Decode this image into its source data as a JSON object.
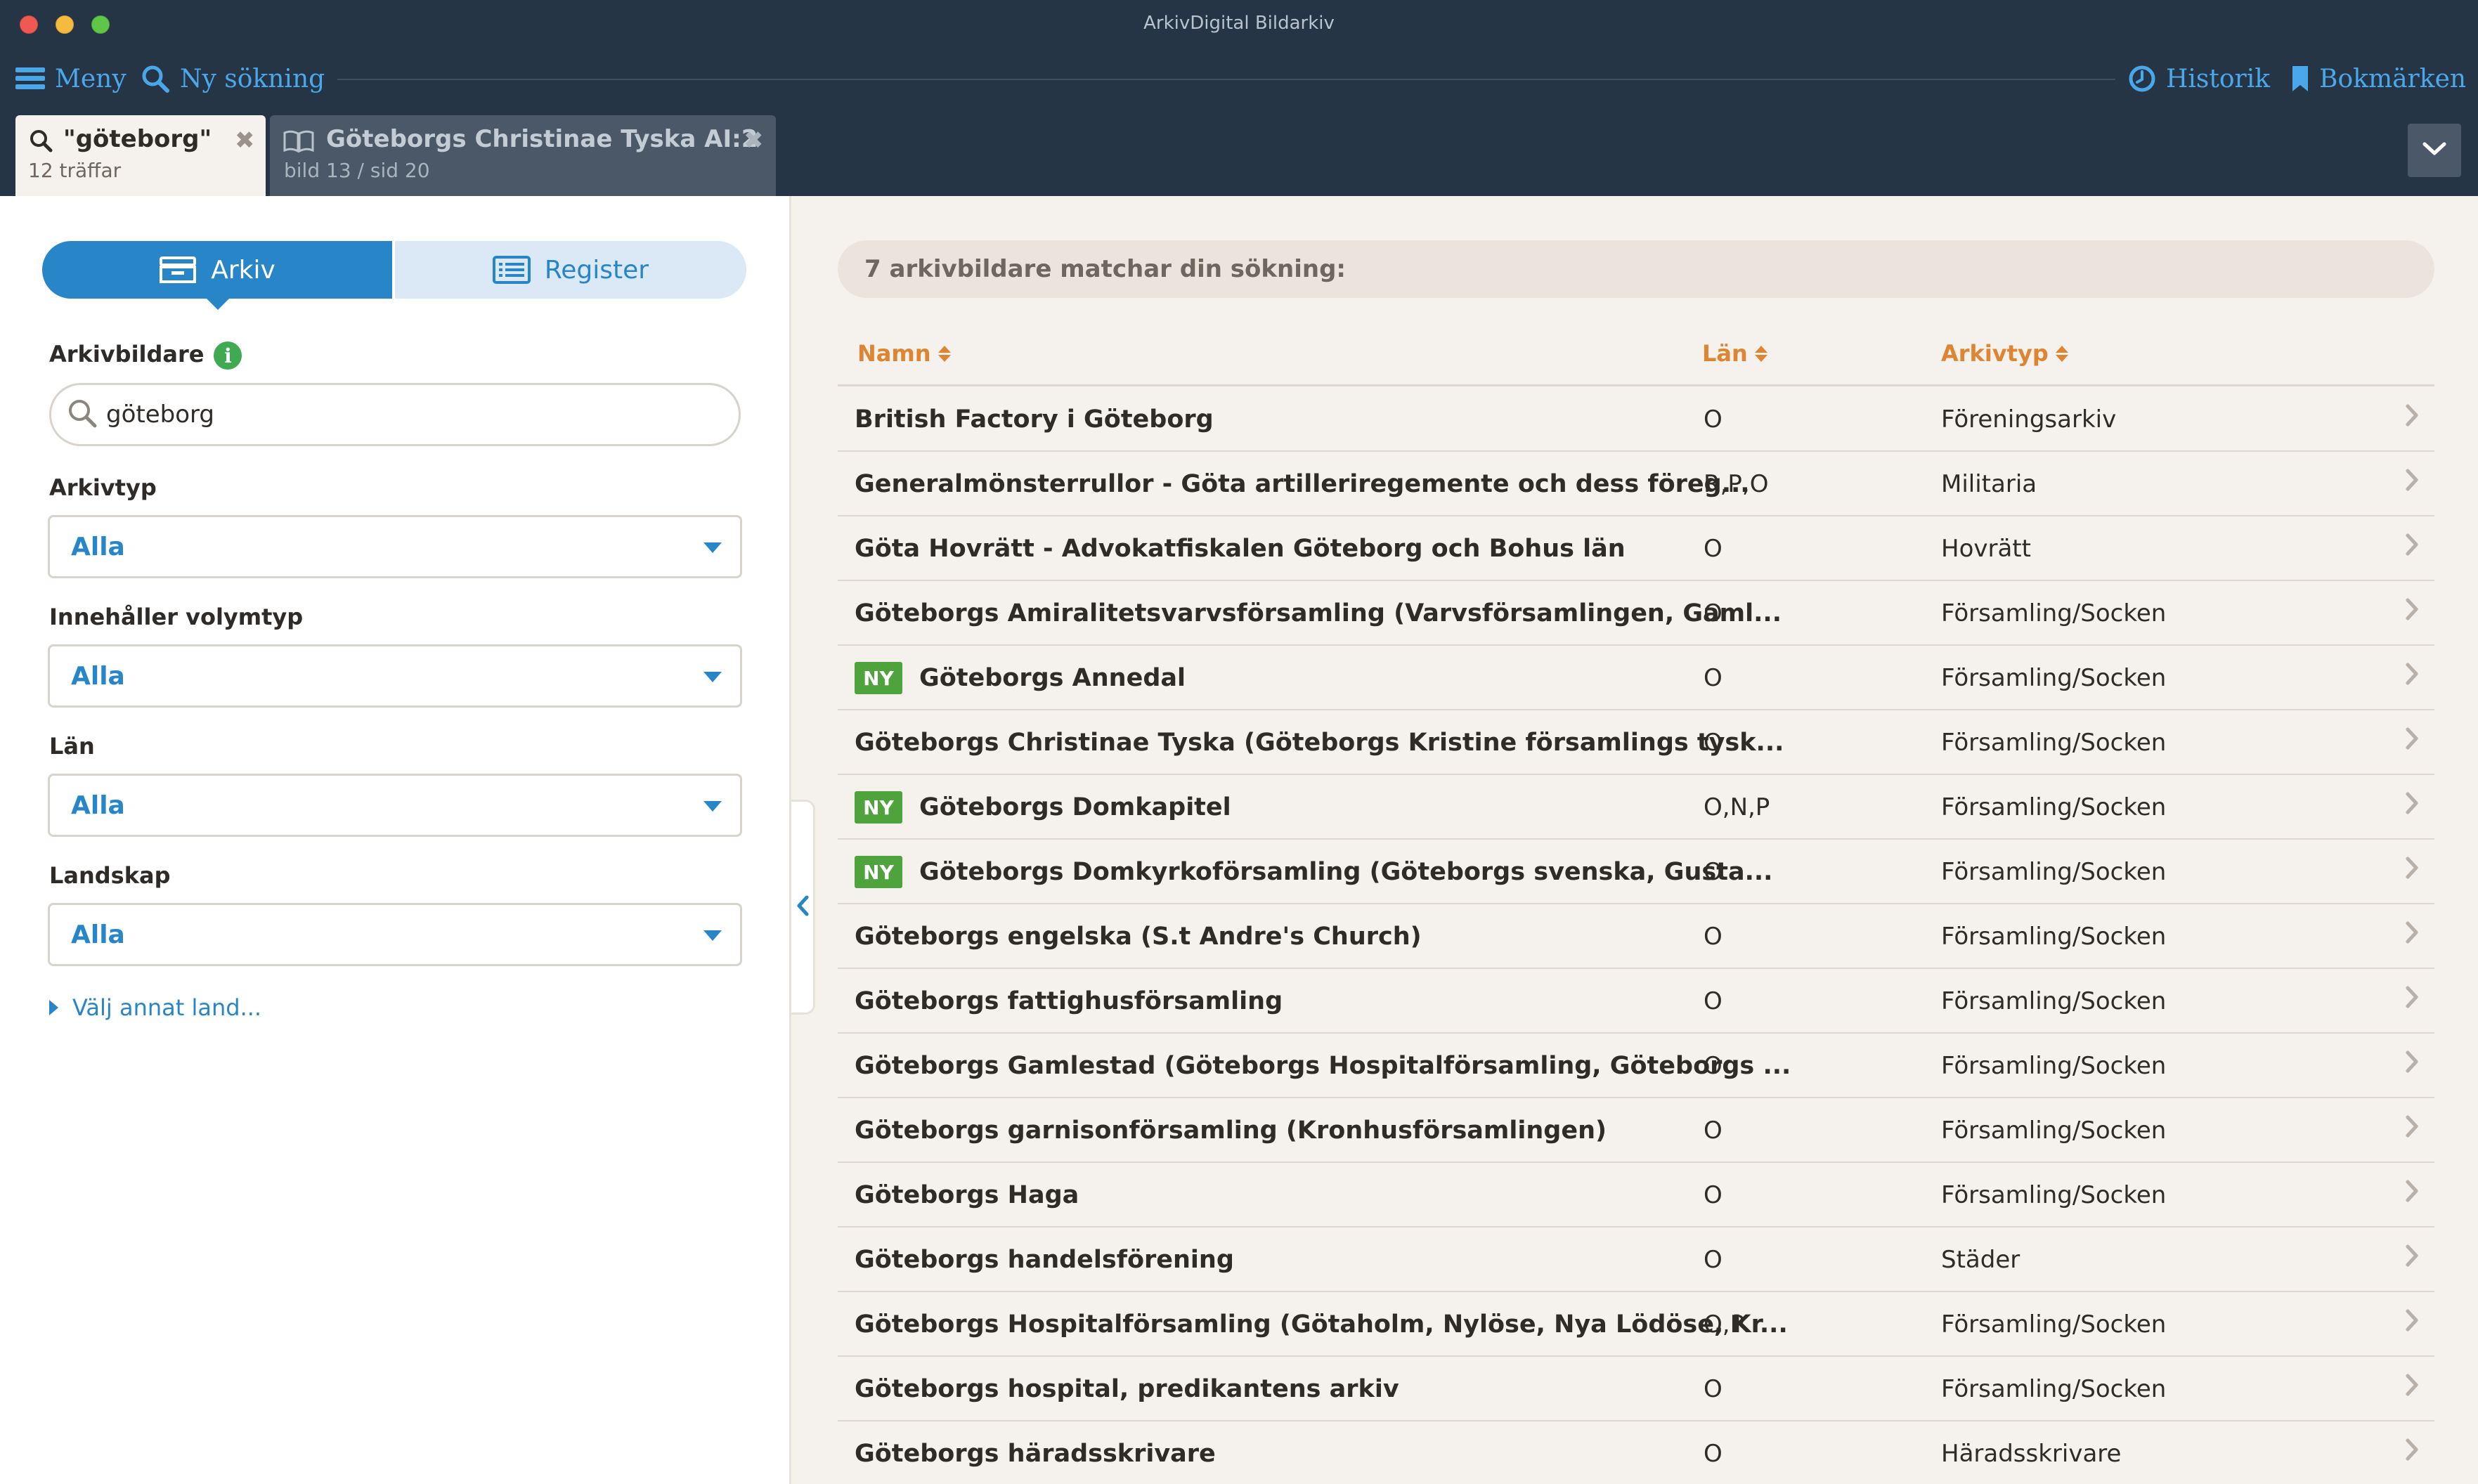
{
  "window": {
    "title": "ArkivDigital Bildarkiv"
  },
  "menubar": {
    "menu": "Meny",
    "new_search": "Ny sökning",
    "history": "Historik",
    "bookmarks": "Bokmärken"
  },
  "tabs": [
    {
      "title": "\"göteborg\"",
      "subtitle": "12 träffar",
      "icon": "search-icon",
      "active": true
    },
    {
      "title": "Göteborgs Christinae Tyska AI:2",
      "subtitle": "bild 13 / sid 20",
      "icon": "book-icon",
      "active": false
    }
  ],
  "sidebar": {
    "segments": {
      "arkiv": "Arkiv",
      "register": "Register"
    },
    "arkivbildare_label": "Arkivbildare",
    "search_value": "göteborg",
    "filters": [
      {
        "label": "Arkivtyp",
        "value": "Alla"
      },
      {
        "label": "Innehåller volymtyp",
        "value": "Alla"
      },
      {
        "label": "Län",
        "value": "Alla"
      },
      {
        "label": "Landskap",
        "value": "Alla"
      }
    ],
    "other_country": "Välj annat land..."
  },
  "results": {
    "banner": "7 arkivbildare matchar din sökning:",
    "columns": {
      "name": "Namn",
      "lan": "Län",
      "type": "Arkivtyp"
    },
    "badge_label": "NY",
    "rows": [
      {
        "name": "British Factory i Göteborg",
        "lan": "O",
        "type": "Föreningsarkiv",
        "new": false
      },
      {
        "name": "Generalmönsterrullor - Göta artilleriregemente och dess föreg...",
        "lan": "R,P,O",
        "type": "Militaria",
        "new": false
      },
      {
        "name": "Göta Hovrätt - Advokatfiskalen Göteborg och Bohus län",
        "lan": "O",
        "type": "Hovrätt",
        "new": false
      },
      {
        "name": "Göteborgs Amiralitetsvarvsförsamling (Varvsförsamlingen, Gaml...",
        "lan": "O",
        "type": "Församling/Socken",
        "new": false
      },
      {
        "name": "Göteborgs Annedal",
        "lan": "O",
        "type": "Församling/Socken",
        "new": true
      },
      {
        "name": "Göteborgs Christinae Tyska (Göteborgs Kristine församlings tysk...",
        "lan": "O",
        "type": "Församling/Socken",
        "new": false
      },
      {
        "name": "Göteborgs Domkapitel",
        "lan": "O,N,P",
        "type": "Församling/Socken",
        "new": true
      },
      {
        "name": "Göteborgs Domkyrkoförsamling (Göteborgs svenska, Gusta...",
        "lan": "O",
        "type": "Församling/Socken",
        "new": true
      },
      {
        "name": "Göteborgs engelska (S.t Andre's Church)",
        "lan": "O",
        "type": "Församling/Socken",
        "new": false
      },
      {
        "name": "Göteborgs fattighusförsamling",
        "lan": "O",
        "type": "Församling/Socken",
        "new": false
      },
      {
        "name": "Göteborgs Gamlestad (Göteborgs Hospitalförsamling, Göteborgs ...",
        "lan": "O",
        "type": "Församling/Socken",
        "new": false
      },
      {
        "name": "Göteborgs garnisonförsamling (Kronhusförsamlingen)",
        "lan": "O",
        "type": "Församling/Socken",
        "new": false
      },
      {
        "name": "Göteborgs Haga",
        "lan": "O",
        "type": "Församling/Socken",
        "new": false
      },
      {
        "name": "Göteborgs handelsförening",
        "lan": "O",
        "type": "Städer",
        "new": false
      },
      {
        "name": "Göteborgs Hospitalförsamling (Götaholm, Nylöse, Nya Lödöse, Kr...",
        "lan": "O,P",
        "type": "Församling/Socken",
        "new": false
      },
      {
        "name": "Göteborgs hospital, predikantens arkiv",
        "lan": "O",
        "type": "Församling/Socken",
        "new": false
      },
      {
        "name": "Göteborgs häradsskrivare",
        "lan": "O",
        "type": "Häradsskrivare",
        "new": false
      }
    ]
  },
  "colors": {
    "topbar": "#253546",
    "accent_blue": "#2785c8",
    "link_blue": "#4aa8ea",
    "sort_orange": "#dd8532",
    "badge_green": "#4fa33d",
    "content_bg": "#f5f1ec"
  }
}
